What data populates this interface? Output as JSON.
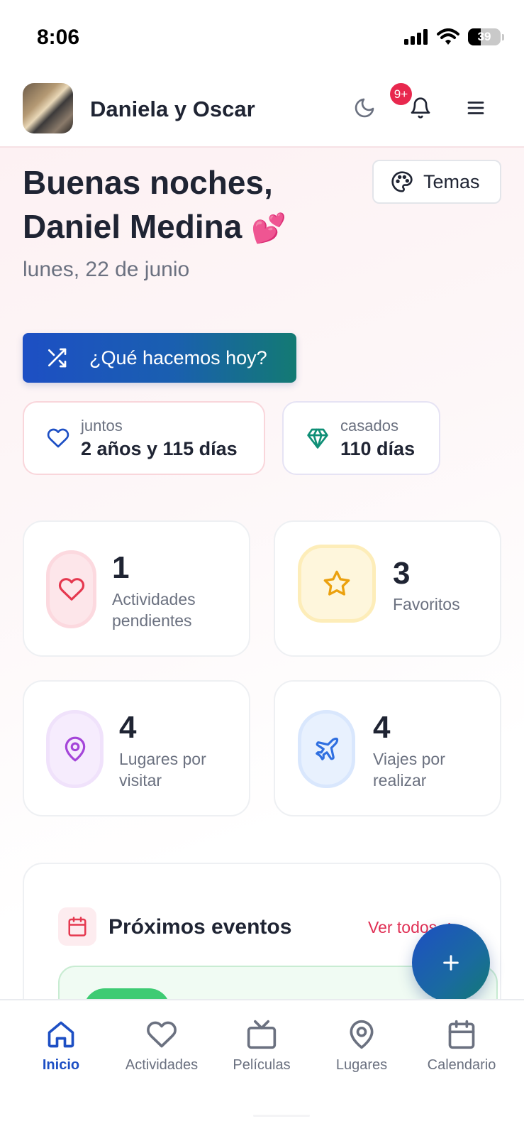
{
  "status_bar": {
    "time": "8:06",
    "battery": "39"
  },
  "header": {
    "couple_name": "Daniela y Oscar",
    "notification_badge": "9+"
  },
  "greeting": {
    "line1": "Buenas noches,",
    "line2": "Daniel Medina",
    "emoji": "💕",
    "date": "lunes, 22 de junio"
  },
  "themes_button": {
    "label": "Temas"
  },
  "cta": {
    "label": "¿Qué hacemos hoy?"
  },
  "counters": {
    "together": {
      "label": "juntos",
      "value": "2 años y 115 días"
    },
    "married": {
      "label": "casados",
      "value": "110 días"
    }
  },
  "stats": [
    {
      "number": "1",
      "label_line1": "Actividades",
      "label_line2": "pendientes",
      "icon": "heart-icon",
      "color": "#e5384f"
    },
    {
      "number": "3",
      "label_line1": "Favoritos",
      "label_line2": "",
      "icon": "star-icon",
      "color": "#eba10f"
    },
    {
      "number": "4",
      "label_line1": "Lugares por",
      "label_line2": "visitar",
      "icon": "map-pin-icon",
      "color": "#a445d9"
    },
    {
      "number": "4",
      "label_line1": "Viajes por",
      "label_line2": "realizar",
      "icon": "plane-icon",
      "color": "#2f6fe0"
    }
  ],
  "events": {
    "title": "Próximos eventos",
    "see_all": "Ver todos"
  },
  "bottom_nav": [
    {
      "label": "Inicio",
      "icon": "home-icon",
      "active": true
    },
    {
      "label": "Actividades",
      "icon": "heart-icon"
    },
    {
      "label": "Películas",
      "icon": "tv-icon"
    },
    {
      "label": "Lugares",
      "icon": "map-pin-icon"
    },
    {
      "label": "Calendario",
      "icon": "calendar-icon"
    }
  ],
  "colors": {
    "primary": "#1d4fc4",
    "accent_pink": "#e02f54",
    "teal": "#137a73"
  }
}
